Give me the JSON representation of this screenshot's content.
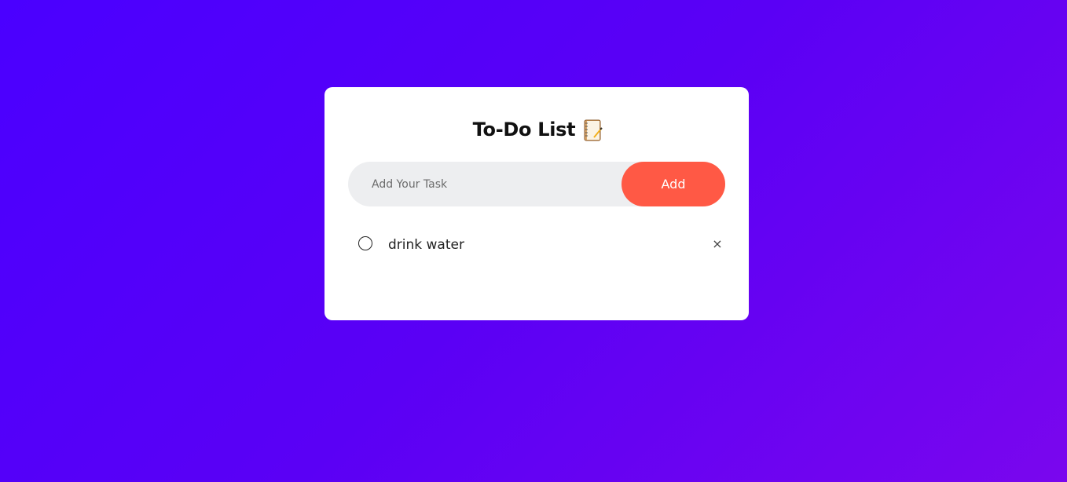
{
  "app": {
    "title": "To-Do List",
    "title_icon": "notebook-icon"
  },
  "input": {
    "placeholder": "Add Your Task",
    "value": ""
  },
  "add_button": {
    "label": "Add"
  },
  "tasks": [
    {
      "text": "drink water",
      "checked": false,
      "delete_symbol": "×"
    }
  ],
  "colors": {
    "accent": "#ff5945",
    "background_start": "#4a00ff",
    "background_end": "#7a06ee",
    "card": "#ffffff",
    "input_bg": "#edeef0"
  }
}
